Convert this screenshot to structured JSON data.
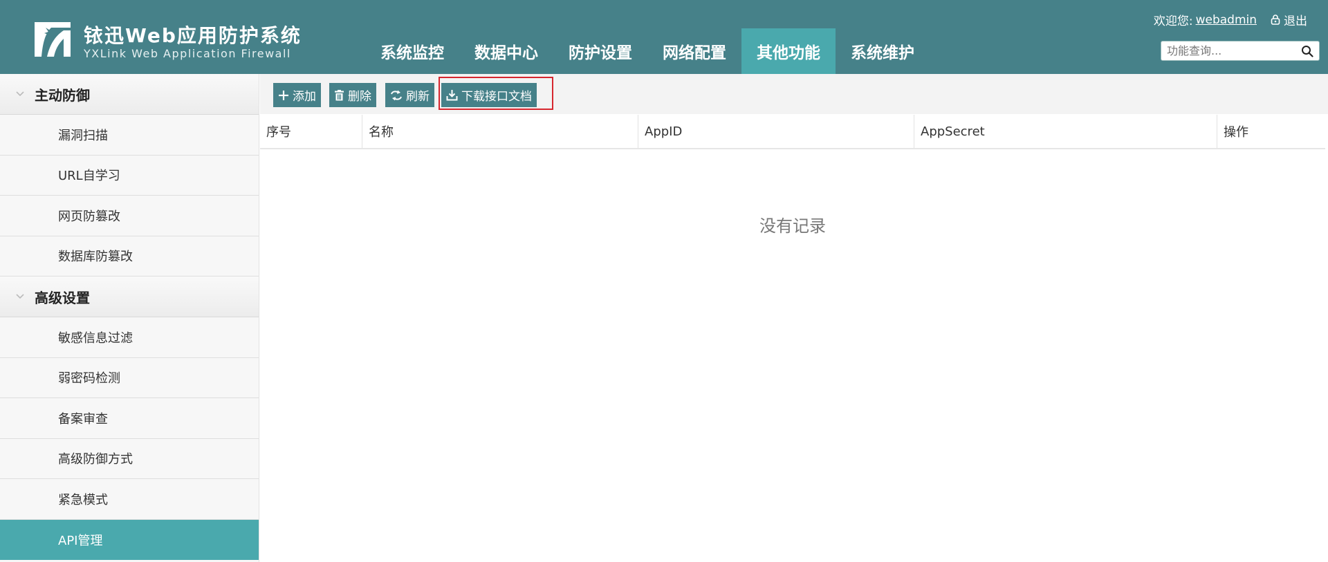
{
  "colors": {
    "header_bg": "#468189",
    "accent": "#4aa9ad",
    "button_bg": "#468189",
    "highlight_border": "#d6262e"
  },
  "brand": {
    "title": "铱迅Web应用防护系统",
    "subtitle": "YXLink Web Application Firewall",
    "logo_icon": "yxlink-logo"
  },
  "nav": {
    "items": [
      {
        "label": "系统监控"
      },
      {
        "label": "数据中心"
      },
      {
        "label": "防护设置"
      },
      {
        "label": "网络配置"
      },
      {
        "label": "其他功能",
        "active": true
      },
      {
        "label": "系统维护"
      }
    ]
  },
  "user": {
    "welcome": "欢迎您:",
    "username": "webadmin",
    "logout_label": "退出",
    "logout_icon": "lock-icon"
  },
  "search": {
    "placeholder": "功能查询...",
    "icon": "search-icon"
  },
  "sidebar": {
    "groups": [
      {
        "label": "主动防御",
        "icon": "chevron-down-icon",
        "items": [
          {
            "label": "漏洞扫描"
          },
          {
            "label": "URL自学习"
          },
          {
            "label": "网页防篡改"
          },
          {
            "label": "数据库防篡改"
          }
        ]
      },
      {
        "label": "高级设置",
        "icon": "chevron-down-icon",
        "items": [
          {
            "label": "敏感信息过滤"
          },
          {
            "label": "弱密码检测"
          },
          {
            "label": "备案审查"
          },
          {
            "label": "高级防御方式"
          },
          {
            "label": "紧急模式"
          },
          {
            "label": "API管理",
            "active": true
          }
        ]
      }
    ]
  },
  "toolbar": {
    "add_label": "添加",
    "add_icon": "plus-icon",
    "delete_label": "删除",
    "delete_icon": "trash-icon",
    "refresh_label": "刷新",
    "refresh_icon": "refresh-icon",
    "download_label": "下载接口文档",
    "download_icon": "download-icon"
  },
  "table": {
    "columns": [
      "序号",
      "名称",
      "AppID",
      "AppSecret",
      "操作"
    ],
    "rows": [],
    "empty_text": "没有记录"
  }
}
